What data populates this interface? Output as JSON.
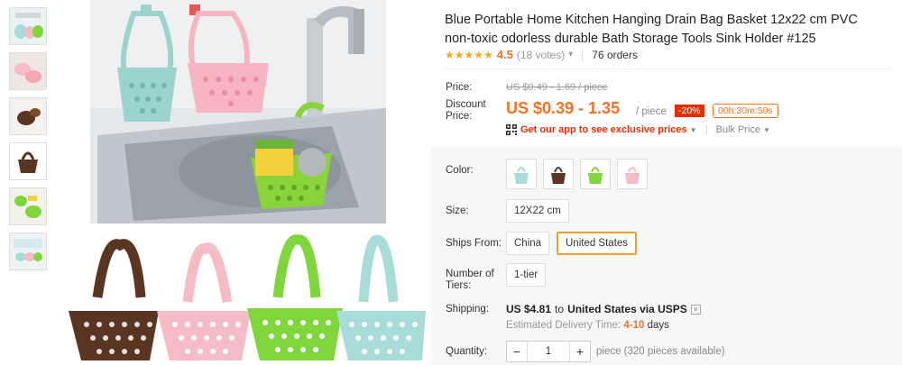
{
  "product": {
    "title": "Blue Portable Home Kitchen Hanging Drain Bag Basket 12x22 cm PVC non-toxic odorless durable Bath Storage Tools Sink Holder #125",
    "rating": {
      "stars": "★★★★★",
      "value": "4.5",
      "votes": "(18 votes)",
      "chevron": "▾",
      "orders": "76 orders"
    }
  },
  "pricing": {
    "price_label": "Price:",
    "old_price": "US $0.49 - 1.69 / piece",
    "discount_label": "Discount Price:",
    "new_price": "US $0.39 - 1.35",
    "unit": "/ piece",
    "discount_badge": "-20%",
    "countdown": "00h:30m:59s",
    "app_promo": "Get our app to see exclusive prices",
    "app_chevron": "▼",
    "bulk_price": "Bulk Price",
    "bulk_chevron": "▼"
  },
  "options": {
    "color_label": "Color:",
    "colors": [
      {
        "name": "Blue",
        "hex": "#a8dcd8"
      },
      {
        "name": "Brown",
        "hex": "#5a3522"
      },
      {
        "name": "Green",
        "hex": "#7fd63a"
      },
      {
        "name": "Pink",
        "hex": "#f6bcc6"
      }
    ],
    "size_label": "Size:",
    "size_value": "12X22 cm",
    "ships_from_label": "Ships From:",
    "ships_from": [
      "China",
      "United States"
    ],
    "ships_from_selected": "United States",
    "tiers_label": "Number of Tiers:",
    "tiers_value": "1-tier"
  },
  "shipping": {
    "label": "Shipping:",
    "cost": "US $4.81",
    "to_text": "to",
    "destination": "United States via USPS",
    "dropdown": "v",
    "delivery_prefix": "Estimated Delivery Time:",
    "delivery_days": "4-10",
    "delivery_suffix": "days"
  },
  "quantity": {
    "label": "Quantity:",
    "minus": "−",
    "value": "1",
    "plus": "+",
    "note": "piece (320 pieces available)"
  },
  "thumbnails": [
    "thumb-1",
    "thumb-2",
    "thumb-3",
    "thumb-4",
    "thumb-5",
    "thumb-6"
  ],
  "colors_theme": {
    "accent": "#f57224",
    "red": "#e62e04",
    "star": "#f5a623"
  }
}
